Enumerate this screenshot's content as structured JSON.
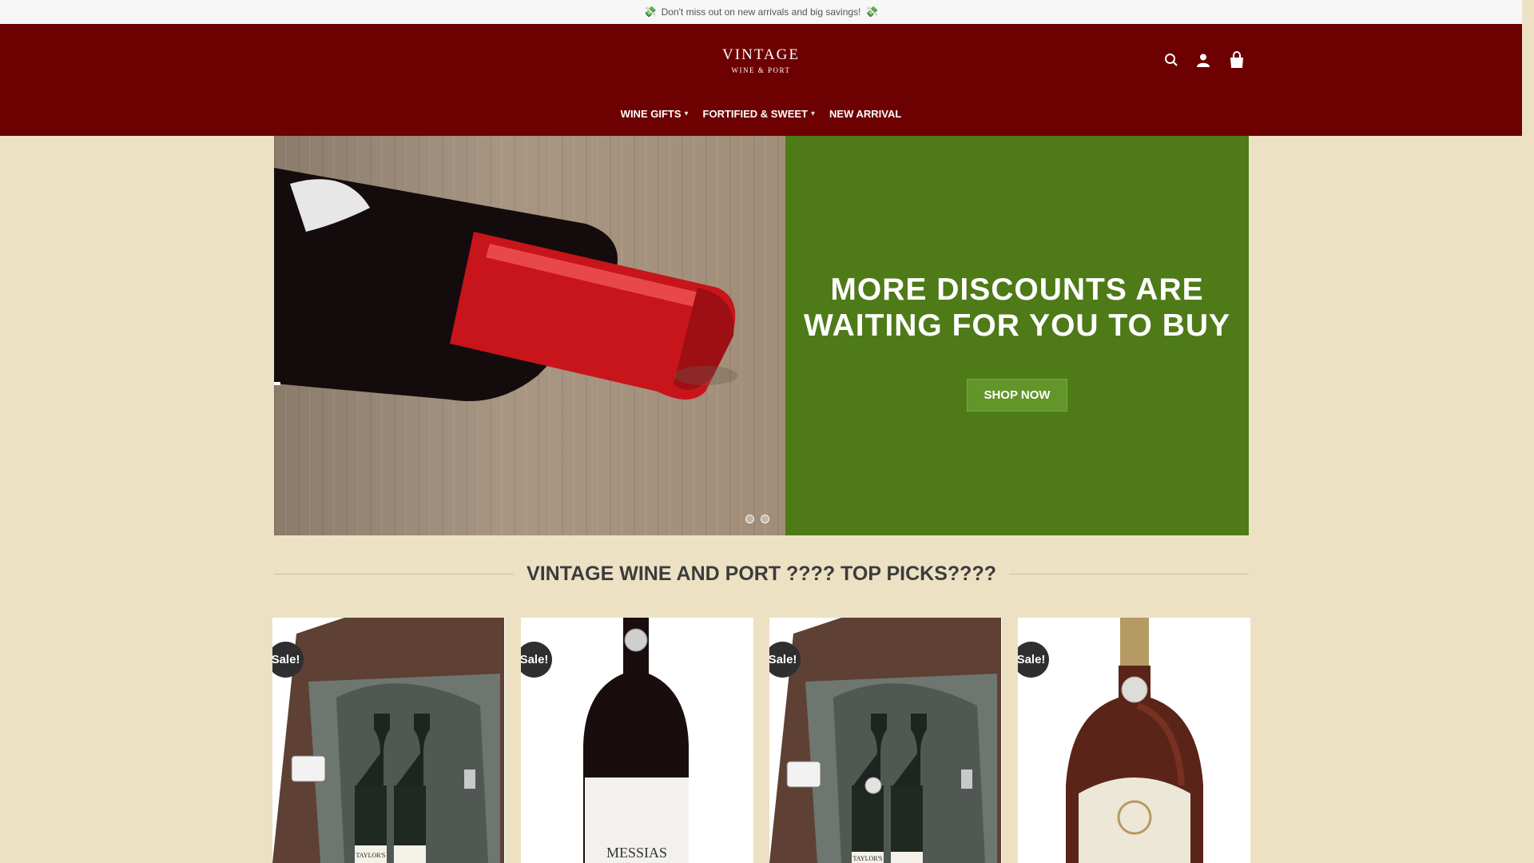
{
  "promo": {
    "text": "Don't miss out on new arrivals and big savings!",
    "icon_left": "money-with-wings-icon",
    "icon_right": "money-with-wings-icon"
  },
  "brand": {
    "name_line1": "VINTAGE",
    "name_line2": "WINE & PORT",
    "header_bg": "#6d0000"
  },
  "header_icons": [
    "search-icon",
    "account-icon",
    "cart-icon"
  ],
  "nav": [
    {
      "label": "WINE GIFTS",
      "has_dropdown": true
    },
    {
      "label": "FORTIFIED & SWEET",
      "has_dropdown": true
    },
    {
      "label": "NEW ARRIVAL",
      "has_dropdown": false
    }
  ],
  "hero": {
    "title_line1": "MORE DISCOUNTS ARE",
    "title_line2": "WAITING FOR YOU TO BUY",
    "button": "SHOP NOW",
    "panel_color": "#4e7a18",
    "slides": 2
  },
  "section": {
    "title": "VINTAGE WINE AND PORT ???? TOP PICKS????"
  },
  "products": [
    {
      "badge": "Sale!",
      "bottle_label": "TAYLOR'S"
    },
    {
      "badge": "Sale!",
      "bottle_label": "MESSIAS"
    },
    {
      "badge": "Sale!",
      "bottle_label": "TAYLOR'S"
    },
    {
      "badge": "Sale!",
      "bottle_label": ""
    }
  ]
}
